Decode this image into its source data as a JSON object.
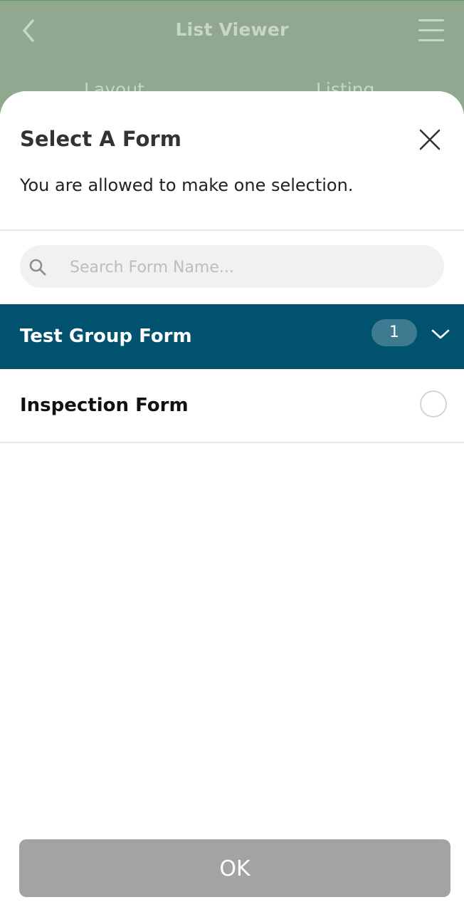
{
  "background_app": {
    "title": "List Viewer",
    "tabs": [
      "Layout",
      "Listing"
    ],
    "header_color": "#8fa88f"
  },
  "sheet": {
    "title": "Select A Form",
    "subtitle": "You are allowed to make one selection.",
    "close_icon": "close-icon"
  },
  "search": {
    "placeholder": "Search Form Name...",
    "value": ""
  },
  "group": {
    "label": "Test Group Form",
    "count": "1",
    "expanded": true,
    "color": "#01526f"
  },
  "items": [
    {
      "label": "Inspection Form",
      "selected": false
    }
  ],
  "ok_button": {
    "label": "OK",
    "enabled": false,
    "color": "#a3a3a3"
  }
}
